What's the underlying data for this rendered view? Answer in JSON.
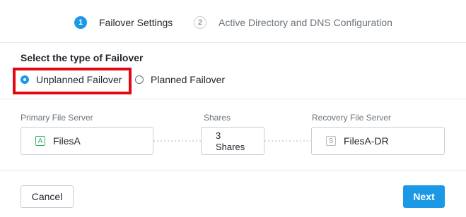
{
  "stepper": {
    "steps": [
      {
        "number": "1",
        "label": "Failover Settings",
        "active": true
      },
      {
        "number": "2",
        "label": "Active Directory and DNS Configuration",
        "active": false
      }
    ]
  },
  "failover": {
    "title": "Select the type of Failover",
    "options": [
      {
        "label": "Unplanned Failover",
        "selected": true
      },
      {
        "label": "Planned Failover",
        "selected": false
      }
    ]
  },
  "mapping": {
    "primary_label": "Primary File Server",
    "primary_icon_letter": "A",
    "primary_name": "FilesA",
    "shares_label": "Shares",
    "shares_count": "3",
    "shares_unit": "Shares",
    "recovery_label": "Recovery File Server",
    "recovery_icon_letter": "S",
    "recovery_name": "FilesA-DR"
  },
  "footer": {
    "cancel_label": "Cancel",
    "next_label": "Next"
  },
  "colors": {
    "accent": "#1b98e6",
    "highlight": "#e30613",
    "primary_icon": "#35b366"
  }
}
